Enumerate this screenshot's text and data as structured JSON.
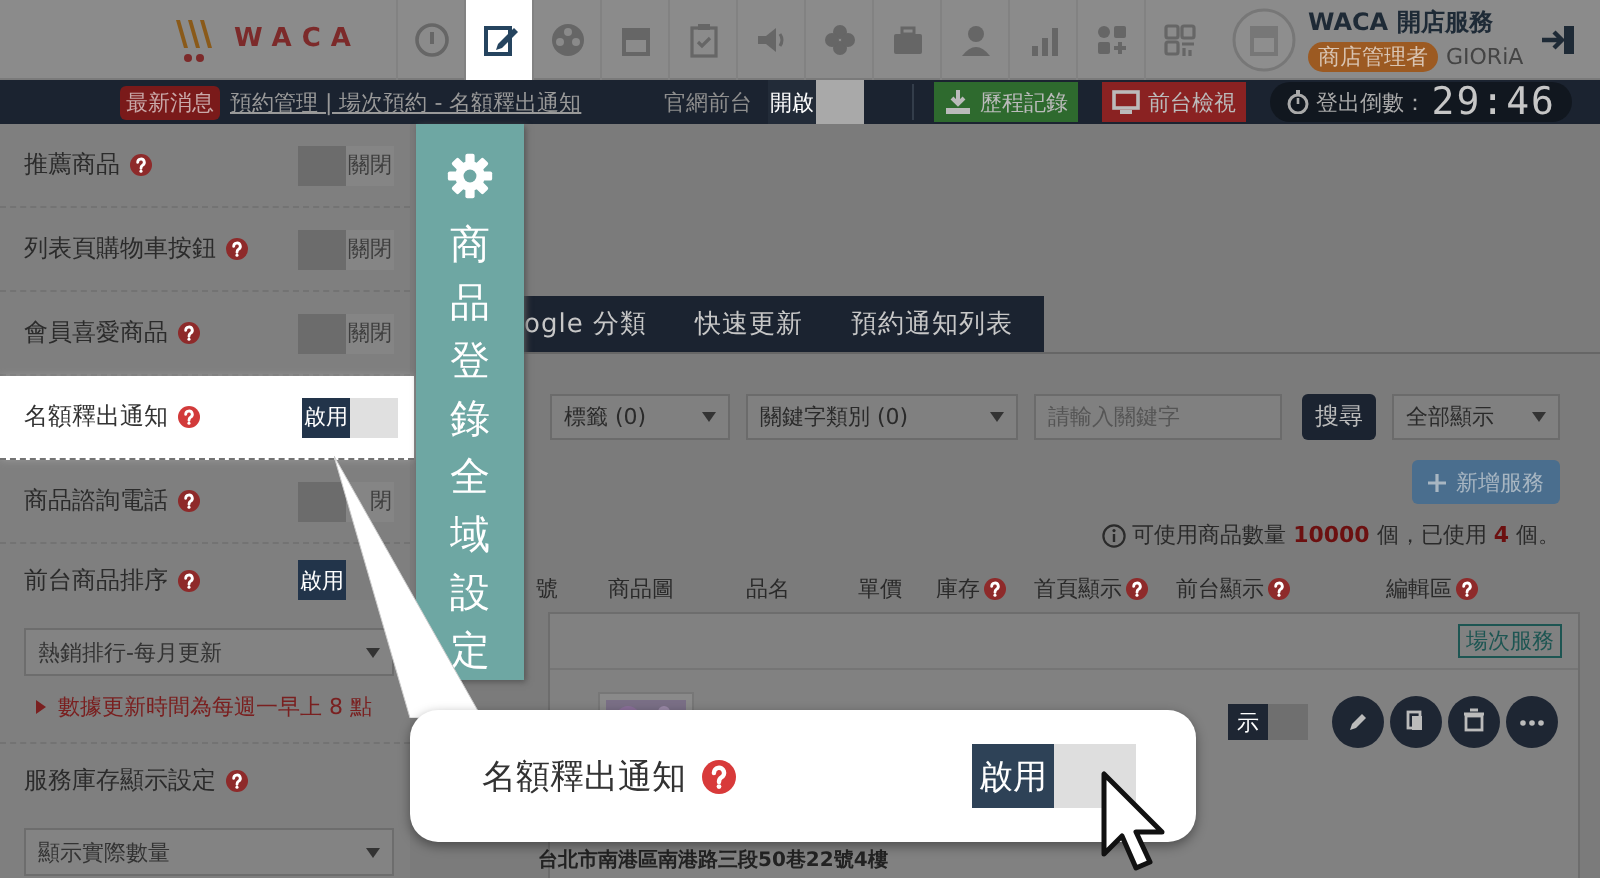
{
  "header": {
    "logo": "WACA",
    "nav_icons": [
      {
        "kind": "info",
        "selected": false
      },
      {
        "kind": "edit",
        "selected": true
      },
      {
        "kind": "film",
        "selected": false
      },
      {
        "kind": "store",
        "selected": false
      },
      {
        "kind": "checklist",
        "selected": false
      },
      {
        "kind": "speaker",
        "selected": false
      },
      {
        "kind": "flower",
        "selected": false
      },
      {
        "kind": "briefcase",
        "selected": false
      },
      {
        "kind": "person",
        "selected": false
      },
      {
        "kind": "chart",
        "selected": false
      },
      {
        "kind": "apps",
        "selected": false
      },
      {
        "kind": "grid",
        "selected": false
      }
    ],
    "store": {
      "title": "WACA 開店服務",
      "role": "商店管理者",
      "user": "GIORiA"
    }
  },
  "subbar": {
    "news_badge": "最新消息",
    "news_link": "預約管理 | 場次預約 - 名額釋出通知",
    "site_label": "官網前台",
    "site_toggle": {
      "text": "開啟",
      "on": true
    },
    "buttons": [
      {
        "label": "歷程記錄",
        "kind": "history"
      },
      {
        "label": "前台檢視",
        "kind": "preview"
      }
    ],
    "countdown": {
      "label": "登出倒數：",
      "time": "29:46"
    }
  },
  "settings": [
    {
      "label": "推薦商品",
      "help": true,
      "toggle": "關閉",
      "on": false,
      "highlighted": false
    },
    {
      "label": "列表頁購物車按鈕",
      "help": true,
      "toggle": "關閉",
      "on": false,
      "highlighted": false
    },
    {
      "label": "會員喜愛商品",
      "help": true,
      "toggle": "關閉",
      "on": false,
      "highlighted": false
    },
    {
      "label": "名額釋出通知",
      "help": true,
      "toggle": "啟用",
      "on": true,
      "highlighted": true
    },
    {
      "label": "商品諮詢電話",
      "help": true,
      "toggle": "閉",
      "on": false,
      "highlighted": false
    },
    {
      "label": "前台商品排序",
      "help": true,
      "toggle": "啟用",
      "on": true,
      "highlighted": false,
      "select": "熱銷排行-每月更新",
      "note": "數據更新時間為每週一早上 8 點"
    },
    {
      "label": "服務庫存顯示設定",
      "help": true,
      "highlighted": false,
      "select": "顯示實際數量"
    }
  ],
  "banner": {
    "title": "商品登錄全域設定"
  },
  "tabs": [
    {
      "label": "ogle 分類",
      "selected": false
    },
    {
      "label": "快速更新",
      "selected": false
    },
    {
      "label": "預約通知列表",
      "selected": false
    }
  ],
  "filters": [
    {
      "kind": "select",
      "value": "標籤 (0)"
    },
    {
      "kind": "select",
      "value": "關鍵字類別 (0)"
    },
    {
      "kind": "input",
      "placeholder": "請輸入關鍵字"
    },
    {
      "kind": "button",
      "label": "搜尋"
    },
    {
      "kind": "select",
      "value": "全部顯示"
    }
  ],
  "add_button": "新增服務",
  "quota": "可使用商品數量 **10000** 個，已使用 **4** 個。",
  "columns": [
    {
      "label": "號",
      "help": false
    },
    {
      "label": "商品圖",
      "help": false
    },
    {
      "label": "品名",
      "help": false
    },
    {
      "label": "單價",
      "help": false
    },
    {
      "label": "庫存",
      "help": true
    },
    {
      "label": "首頁顯示",
      "help": true
    },
    {
      "label": "前台顯示",
      "help": true
    },
    {
      "label": "編輯區",
      "help": true
    }
  ],
  "card": {
    "tag": "場次服務",
    "display_toggle": {
      "text": "示",
      "on": true
    },
    "actions": [
      {
        "kind": "edit"
      },
      {
        "kind": "copy"
      },
      {
        "kind": "delete"
      },
      {
        "kind": "more"
      }
    ],
    "address": "台北市南港區南港路三段50巷22號4樓"
  },
  "callout": {
    "label": "名額釋出通知",
    "help": true,
    "toggle": "啟用",
    "on": true
  }
}
